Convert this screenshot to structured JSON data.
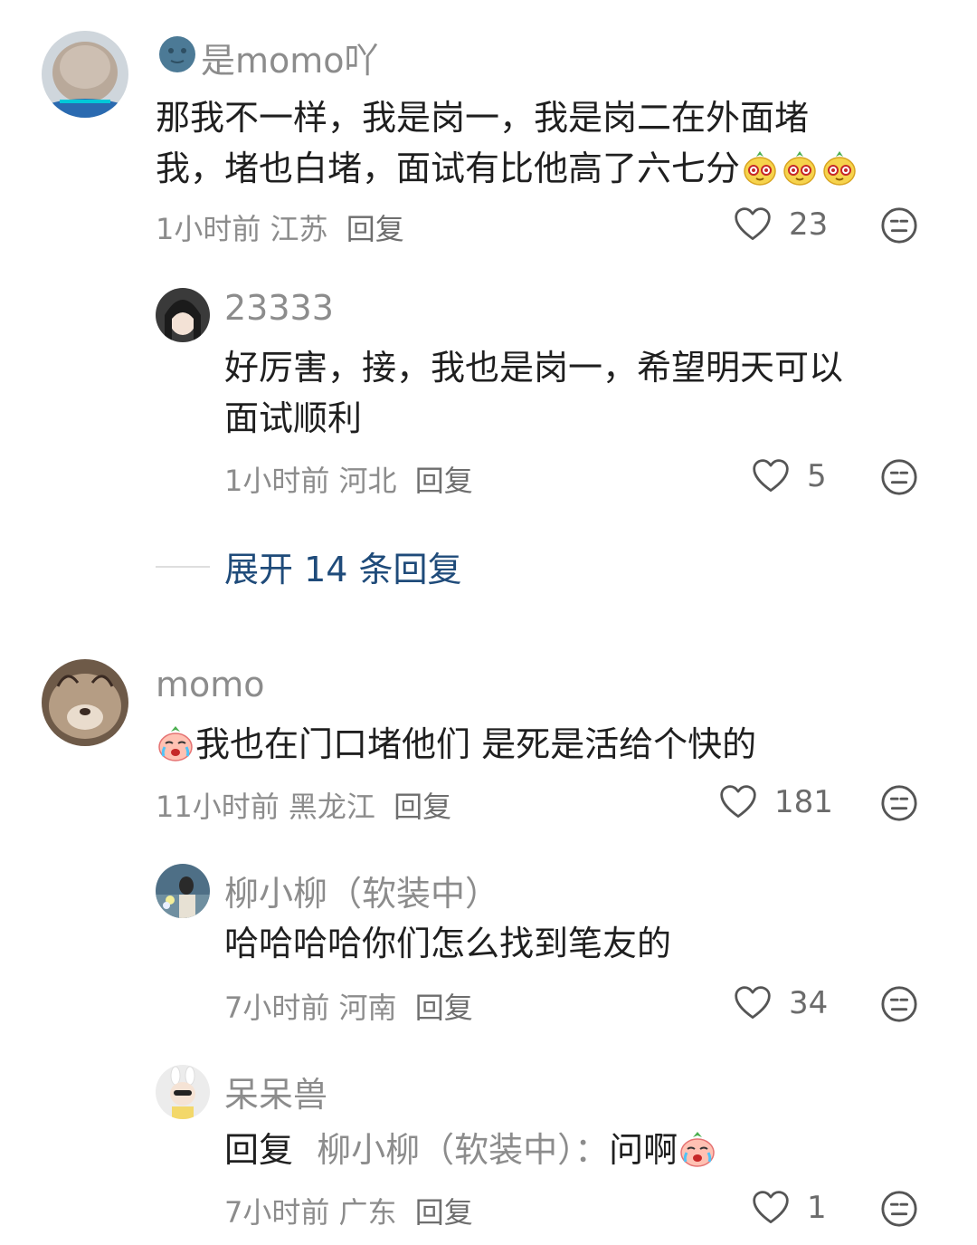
{
  "comments": [
    {
      "username": "是momo吖",
      "text_line1": "那我不一样，我是岗一，我是岗二在外面堵",
      "text_line2": "我，堵也白堵，面试有比他高了六七分",
      "time": "1小时前",
      "location": "江苏",
      "reply_label": "回复",
      "likes": "23",
      "avatar": "bald-head-avatar",
      "username_icon": "blue-moon-face-icon",
      "emojis": [
        "pear-sly-emoji",
        "pear-sly-emoji",
        "pear-sly-emoji"
      ]
    },
    {
      "username": "23333",
      "text_line1": "好厉害，接，我也是岗一，希望明天可以",
      "text_line2": "面试顺利",
      "time": "1小时前",
      "location": "河北",
      "reply_label": "回复",
      "likes": "5",
      "avatar": "girl-selfie-avatar"
    },
    {
      "username": "momo",
      "text": "我也在门口堵他们  是死是活给个快的",
      "time": "11小时前",
      "location": "黑龙江",
      "reply_label": "回复",
      "likes": "181",
      "avatar": "cat-avatar",
      "emojis": [
        "peach-crying-emoji"
      ]
    },
    {
      "username": "柳小柳（软装中）",
      "text": "哈哈哈哈你们怎么找到笔友的",
      "time": "7小时前",
      "location": "河南",
      "reply_label": "回复",
      "likes": "34",
      "avatar": "girl-flowers-avatar"
    },
    {
      "username": "呆呆兽",
      "reply_prefix": "回复",
      "reply_to": "柳小柳（软装中）：",
      "text": "问啊",
      "time": "7小时前",
      "location": "广东",
      "reply_label": "回复",
      "likes": "1",
      "avatar": "bunny-hat-girl-avatar",
      "emojis": [
        "peach-crying-emoji"
      ]
    }
  ],
  "expand_replies": "展开 14 条回复",
  "colors": {
    "secondary_text": "#8c8c8c",
    "link": "#1f4b7a",
    "primary_text": "#1f1f1f"
  }
}
